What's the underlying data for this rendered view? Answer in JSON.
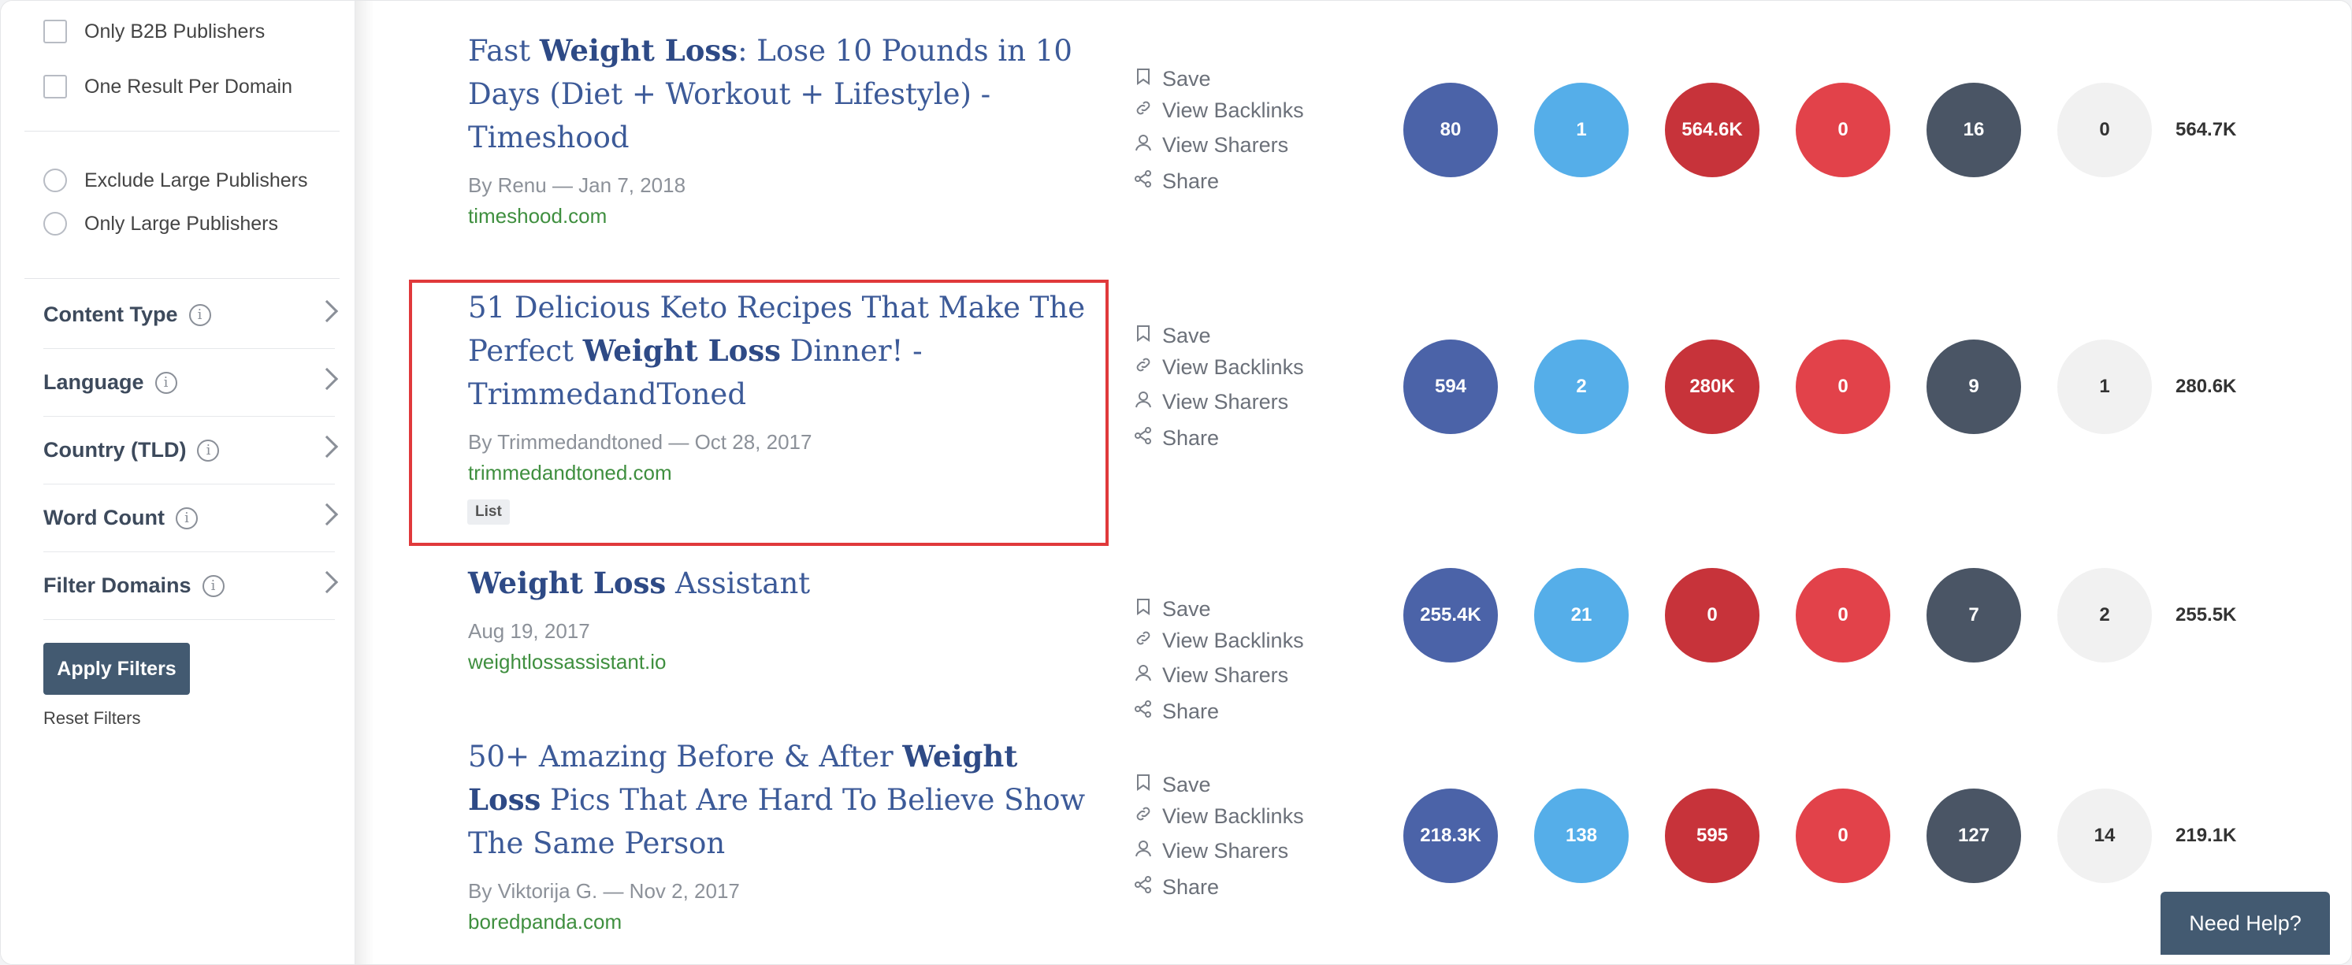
{
  "colors": {
    "circle_blue_dark": "#4b63a8",
    "circle_blue_light": "#55aee9",
    "circle_red_dark": "#c7333a",
    "circle_red": "#e2424a",
    "circle_slate": "#4a5565",
    "circle_gray": "#f1f1f1",
    "highlight": "#e0393b"
  },
  "sidebar": {
    "checkboxes": [
      {
        "label": "Only B2B Publishers",
        "checked": false
      },
      {
        "label": "One Result Per Domain",
        "checked": false
      }
    ],
    "radios": [
      {
        "label": "Exclude Large Publishers",
        "selected": false
      },
      {
        "label": "Only Large Publishers",
        "selected": false
      }
    ],
    "filters": [
      {
        "label": "Content Type"
      },
      {
        "label": "Language"
      },
      {
        "label": "Country (TLD)"
      },
      {
        "label": "Word Count"
      },
      {
        "label": "Filter Domains"
      }
    ],
    "apply_label": "Apply Filters",
    "reset_label": "Reset Filters"
  },
  "actions": {
    "save": "Save",
    "backlinks": "View Backlinks",
    "sharers": "View Sharers",
    "share": "Share"
  },
  "results": [
    {
      "title_parts": [
        "Fast ",
        "Weight Loss",
        ": Lose 10 Pounds in 10 Days (Diet + Workout + Lifestyle) - Timeshood"
      ],
      "byline": "By Renu — Jan 7, 2018",
      "domain": "timeshood.com",
      "tag": "",
      "metrics": [
        "80",
        "1",
        "564.6K",
        "0",
        "16",
        "0"
      ],
      "total": "564.7K"
    },
    {
      "title_parts": [
        "51 Delicious Keto Recipes That Make The Perfect ",
        "Weight Loss",
        " Dinner! - TrimmedandToned"
      ],
      "byline": "By Trimmedandtoned — Oct 28, 2017",
      "domain": "trimmedandtoned.com",
      "tag": "List",
      "metrics": [
        "594",
        "2",
        "280K",
        "0",
        "9",
        "1"
      ],
      "total": "280.6K"
    },
    {
      "title_parts": [
        "",
        "Weight Loss",
        " Assistant"
      ],
      "byline": "Aug 19, 2017",
      "domain": "weightlossassistant.io",
      "tag": "",
      "metrics": [
        "255.4K",
        "21",
        "0",
        "0",
        "7",
        "2"
      ],
      "total": "255.5K"
    },
    {
      "title_parts": [
        "50+ Amazing Before & After ",
        "Weight Loss",
        " Pics That Are Hard To Believe Show The Same Person"
      ],
      "byline": "By Viktorija G. — Nov 2, 2017",
      "domain": "boredpanda.com",
      "tag": "",
      "metrics": [
        "218.3K",
        "138",
        "595",
        "0",
        "127",
        "14"
      ],
      "total": "219.1K"
    }
  ],
  "help_label": "Need Help?"
}
